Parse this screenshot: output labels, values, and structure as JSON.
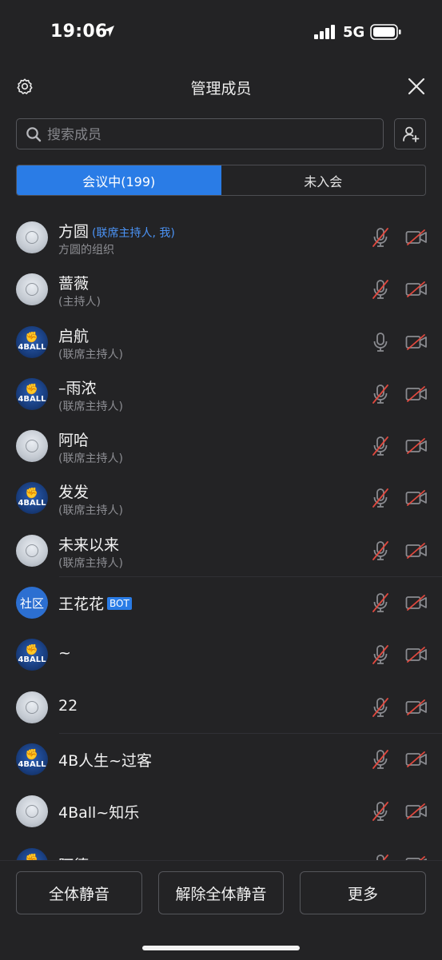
{
  "status": {
    "time": "19:06",
    "network": "5G"
  },
  "header": {
    "title": "管理成员"
  },
  "search": {
    "placeholder": "搜索成员"
  },
  "tabs": [
    {
      "label": "会议中(199)",
      "active": true
    },
    {
      "label": "未入会",
      "active": false
    }
  ],
  "members": [
    {
      "name": "方圆",
      "role_inline": "(联席主持人, 我)",
      "sub": "方圆的组织",
      "avatar": "default",
      "mic": "muted",
      "camera": "off"
    },
    {
      "name": "蔷薇",
      "sub": "(主持人)",
      "avatar": "default",
      "mic": "muted",
      "camera": "off"
    },
    {
      "name": "启航",
      "sub": "(联席主持人)",
      "avatar": "4ball",
      "mic": "on",
      "camera": "off"
    },
    {
      "name": "–雨浓",
      "sub": "(联席主持人)",
      "avatar": "4ball",
      "mic": "muted",
      "camera": "off"
    },
    {
      "name": "阿哈",
      "sub": "(联席主持人)",
      "avatar": "default",
      "mic": "muted",
      "camera": "off"
    },
    {
      "name": "发发",
      "sub": "(联席主持人)",
      "avatar": "4ball",
      "mic": "muted",
      "camera": "off"
    },
    {
      "name": "未来以来",
      "sub": "(联席主持人)",
      "avatar": "default",
      "mic": "muted",
      "camera": "off"
    },
    {
      "name": "王花花",
      "badge": "BOT",
      "avatar": "text",
      "avatar_text": "社区",
      "mic": "muted",
      "camera": "off"
    },
    {
      "name": "~",
      "avatar": "4ball",
      "mic": "muted",
      "camera": "off"
    },
    {
      "name": "22",
      "avatar": "default",
      "mic": "muted",
      "camera": "off"
    },
    {
      "name": "4B人生~过客",
      "avatar": "4ball",
      "mic": "muted",
      "camera": "off"
    },
    {
      "name": "4Ball~知乐",
      "avatar": "default",
      "mic": "muted",
      "camera": "off"
    },
    {
      "name": "阿德",
      "avatar": "4ball",
      "mic": "muted",
      "camera": "off"
    }
  ],
  "avatar_4ball_text": "4BALL",
  "footer": {
    "mute_all": "全体静音",
    "unmute_all": "解除全体静音",
    "more": "更多"
  },
  "colors": {
    "accent": "#2a7ce6",
    "background": "#232325",
    "muted_slash": "#e0483e"
  }
}
